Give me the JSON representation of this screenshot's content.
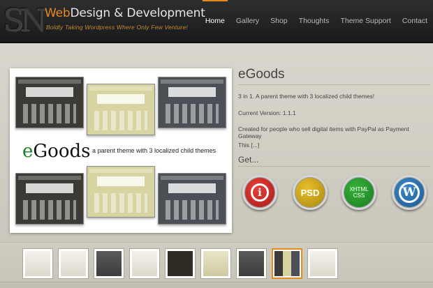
{
  "header": {
    "logo_monogram": "SN",
    "title_accent": "Web",
    "title_rest": "Design & Development",
    "tagline": "Boldly Taking Wordpress Where Only Few Venture!"
  },
  "nav": {
    "items": [
      {
        "label": "Home",
        "active": true
      },
      {
        "label": "Gallery",
        "active": false
      },
      {
        "label": "Shop",
        "active": false
      },
      {
        "label": "Thoughts",
        "active": false
      },
      {
        "label": "Theme Support",
        "active": false
      },
      {
        "label": "Contact",
        "active": false
      }
    ],
    "accent_color": "#e8891c"
  },
  "feature": {
    "logo_e": "e",
    "logo_rest": "Goods",
    "tagline": "a parent theme with 3 localized child themes"
  },
  "post": {
    "title": "eGoods",
    "intro": "3 in 1. A parent theme with 3 localized child themes!",
    "version": "Current Version: 1.1.1",
    "description": "Created for people who sell digital items with PayPal as Payment Gateway",
    "more": "This [...]",
    "get_heading": "Get..."
  },
  "badges": {
    "info_icon": "info-icon",
    "psd_label": "PSD",
    "xhtml_label": "XHTML",
    "css_label": "CSS",
    "wp_icon": "wordpress-icon",
    "info_glyph": "i",
    "wp_glyph": "W"
  },
  "thumbnails": {
    "count_visible": 9,
    "active_index": 7
  }
}
